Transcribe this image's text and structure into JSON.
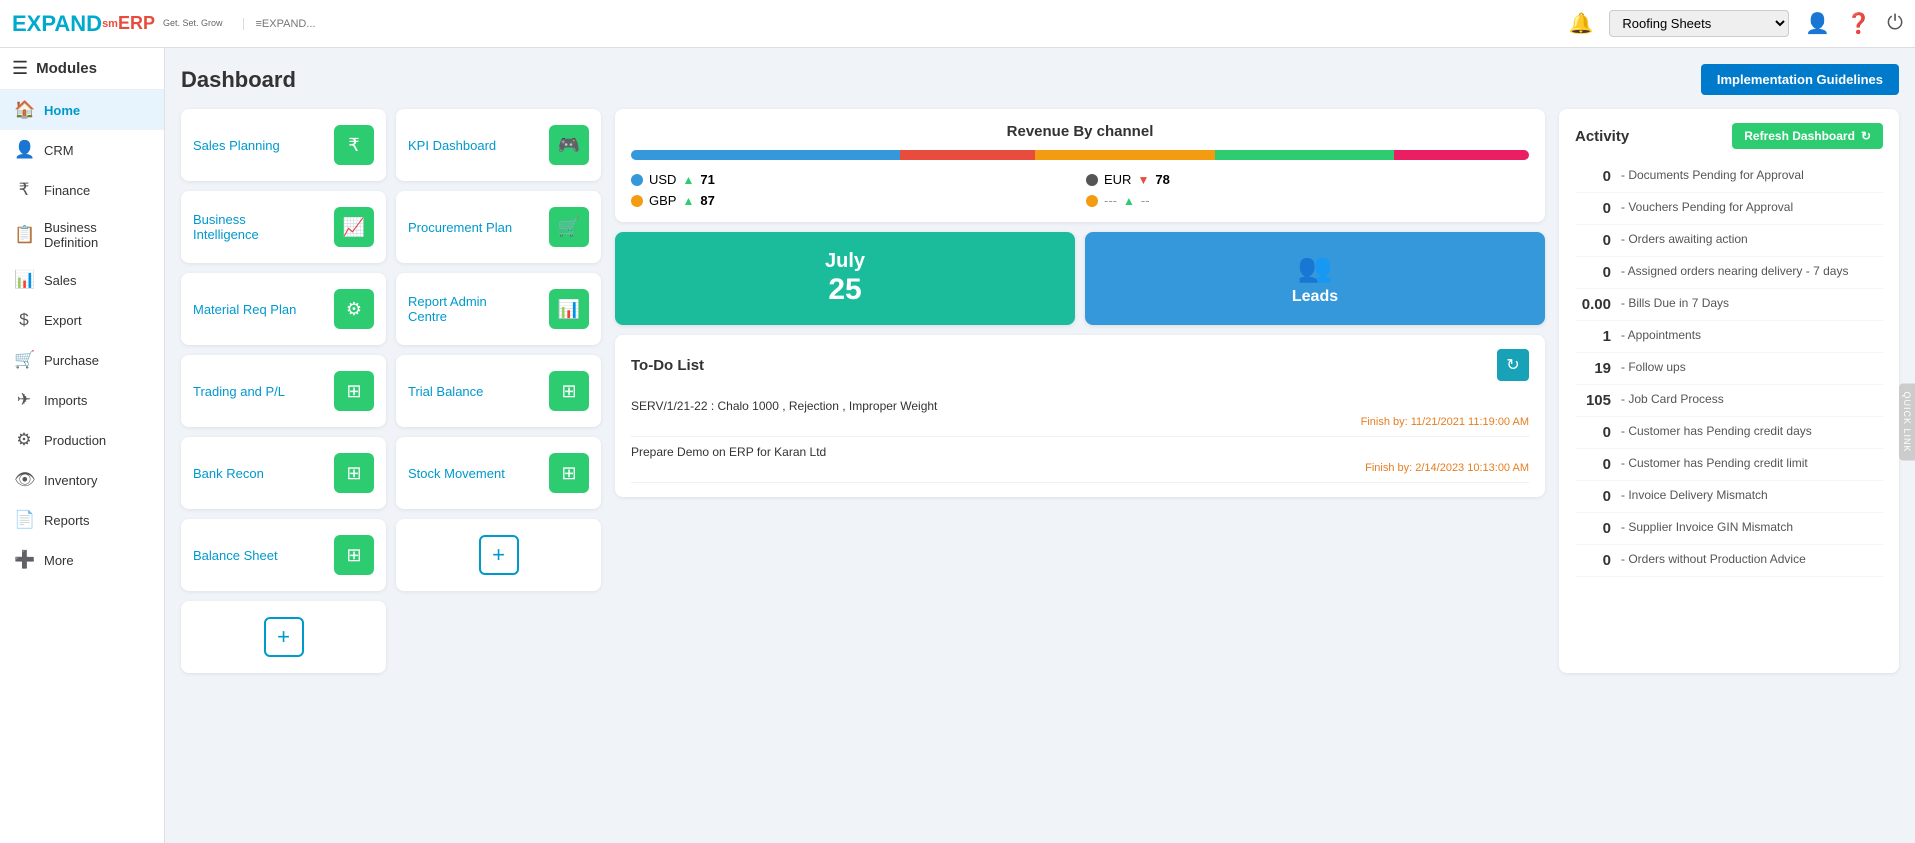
{
  "topbar": {
    "logo_text": "EXPAND",
    "logo_sm": "sm",
    "logo_erp": "ERP",
    "logo_tagline": "Get. Set. Grow",
    "logo2_text": "≡EXPAND...",
    "company_options": [
      "Roofing Sheets"
    ],
    "company_selected": "Roofing Sheets"
  },
  "sidebar": {
    "header_label": "Modules",
    "items": [
      {
        "id": "home",
        "label": "Home",
        "icon": "🏠"
      },
      {
        "id": "crm",
        "label": "CRM",
        "icon": "👤"
      },
      {
        "id": "finance",
        "label": "Finance",
        "icon": "₹"
      },
      {
        "id": "business-def",
        "label": "Business Definition",
        "icon": "📋"
      },
      {
        "id": "sales",
        "label": "Sales",
        "icon": "📊"
      },
      {
        "id": "export",
        "label": "Export",
        "icon": "$"
      },
      {
        "id": "purchase",
        "label": "Purchase",
        "icon": "🛒"
      },
      {
        "id": "imports",
        "label": "Imports",
        "icon": "✈"
      },
      {
        "id": "production",
        "label": "Production",
        "icon": "⚙"
      },
      {
        "id": "inventory",
        "label": "Inventory",
        "icon": "👁"
      },
      {
        "id": "reports",
        "label": "Reports",
        "icon": "📄"
      },
      {
        "id": "more",
        "label": "More",
        "icon": "+"
      }
    ]
  },
  "dashboard": {
    "title": "Dashboard",
    "impl_btn": "Implementation Guidelines"
  },
  "cards": [
    {
      "id": "sales-planning",
      "label": "Sales Planning",
      "icon": "₹"
    },
    {
      "id": "kpi-dashboard",
      "label": "KPI Dashboard",
      "icon": "🎮"
    },
    {
      "id": "business-intelligence",
      "label": "Business Intelligence",
      "icon": "📈"
    },
    {
      "id": "procurement-plan",
      "label": "Procurement Plan",
      "icon": "🛒"
    },
    {
      "id": "material-req-plan",
      "label": "Material Req Plan",
      "icon": "⚙"
    },
    {
      "id": "report-admin-centre",
      "label": "Report Admin Centre",
      "icon": "📊"
    },
    {
      "id": "trading-pl",
      "label": "Trading and P/L",
      "icon": "⊞"
    },
    {
      "id": "trial-balance",
      "label": "Trial Balance",
      "icon": "⊞"
    },
    {
      "id": "bank-recon",
      "label": "Bank Recon",
      "icon": "⊞"
    },
    {
      "id": "stock-movement",
      "label": "Stock Movement",
      "icon": "⊞"
    },
    {
      "id": "balance-sheet",
      "label": "Balance Sheet",
      "icon": "⊞"
    },
    {
      "id": "add-1",
      "label": "",
      "icon": "+"
    },
    {
      "id": "add-2",
      "label": "",
      "icon": "+"
    }
  ],
  "revenue": {
    "title": "Revenue By channel",
    "bars": [
      {
        "color": "#3498db",
        "pct": 30
      },
      {
        "color": "#e74c3c",
        "pct": 15
      },
      {
        "color": "#f39c12",
        "pct": 20
      },
      {
        "color": "#2ecc71",
        "pct": 20
      },
      {
        "color": "#e91e63",
        "pct": 15
      }
    ],
    "legend": [
      {
        "dot": "#3498db",
        "currency": "USD",
        "arrow": "up",
        "value": "71"
      },
      {
        "dot": "#555",
        "currency": "EUR",
        "arrow": "down",
        "value": "78"
      },
      {
        "dot": "#f39c12",
        "currency": "GBP",
        "arrow": "up",
        "value": "87"
      },
      {
        "dot": "#f39c12",
        "currency": "---",
        "arrow": "up",
        "value": "--"
      }
    ]
  },
  "july_tile": {
    "month": "July",
    "day": "25"
  },
  "leads_tile": {
    "icon": "👥",
    "label": "Leads"
  },
  "todo": {
    "title": "To-Do List",
    "items": [
      {
        "desc": "SERV/1/21-22 : Chalo 1000 , Rejection , Improper Weight",
        "date": "Finish by: 11/21/2021 11:19:00 AM"
      },
      {
        "desc": "Prepare Demo on ERP for Karan Ltd",
        "date": "Finish by: 2/14/2023 10:13:00 AM"
      }
    ]
  },
  "activity": {
    "title": "Activity",
    "refresh_btn": "Refresh Dashboard",
    "items": [
      {
        "count": "0",
        "desc": "- Documents Pending for Approval"
      },
      {
        "count": "0",
        "desc": "- Vouchers Pending for Approval"
      },
      {
        "count": "0",
        "desc": "- Orders awaiting action"
      },
      {
        "count": "0",
        "desc": "- Assigned orders nearing delivery - 7 days"
      },
      {
        "count": "0.00",
        "desc": "- Bills Due in 7 Days"
      },
      {
        "count": "1",
        "desc": "- Appointments"
      },
      {
        "count": "19",
        "desc": "- Follow ups"
      },
      {
        "count": "105",
        "desc": "- Job Card Process"
      },
      {
        "count": "0",
        "desc": "- Customer has Pending credit days"
      },
      {
        "count": "0",
        "desc": "- Customer has Pending credit limit"
      },
      {
        "count": "0",
        "desc": "- Invoice Delivery Mismatch"
      },
      {
        "count": "0",
        "desc": "- Supplier Invoice GIN Mismatch"
      },
      {
        "count": "0",
        "desc": "- Orders without Production Advice"
      }
    ]
  }
}
